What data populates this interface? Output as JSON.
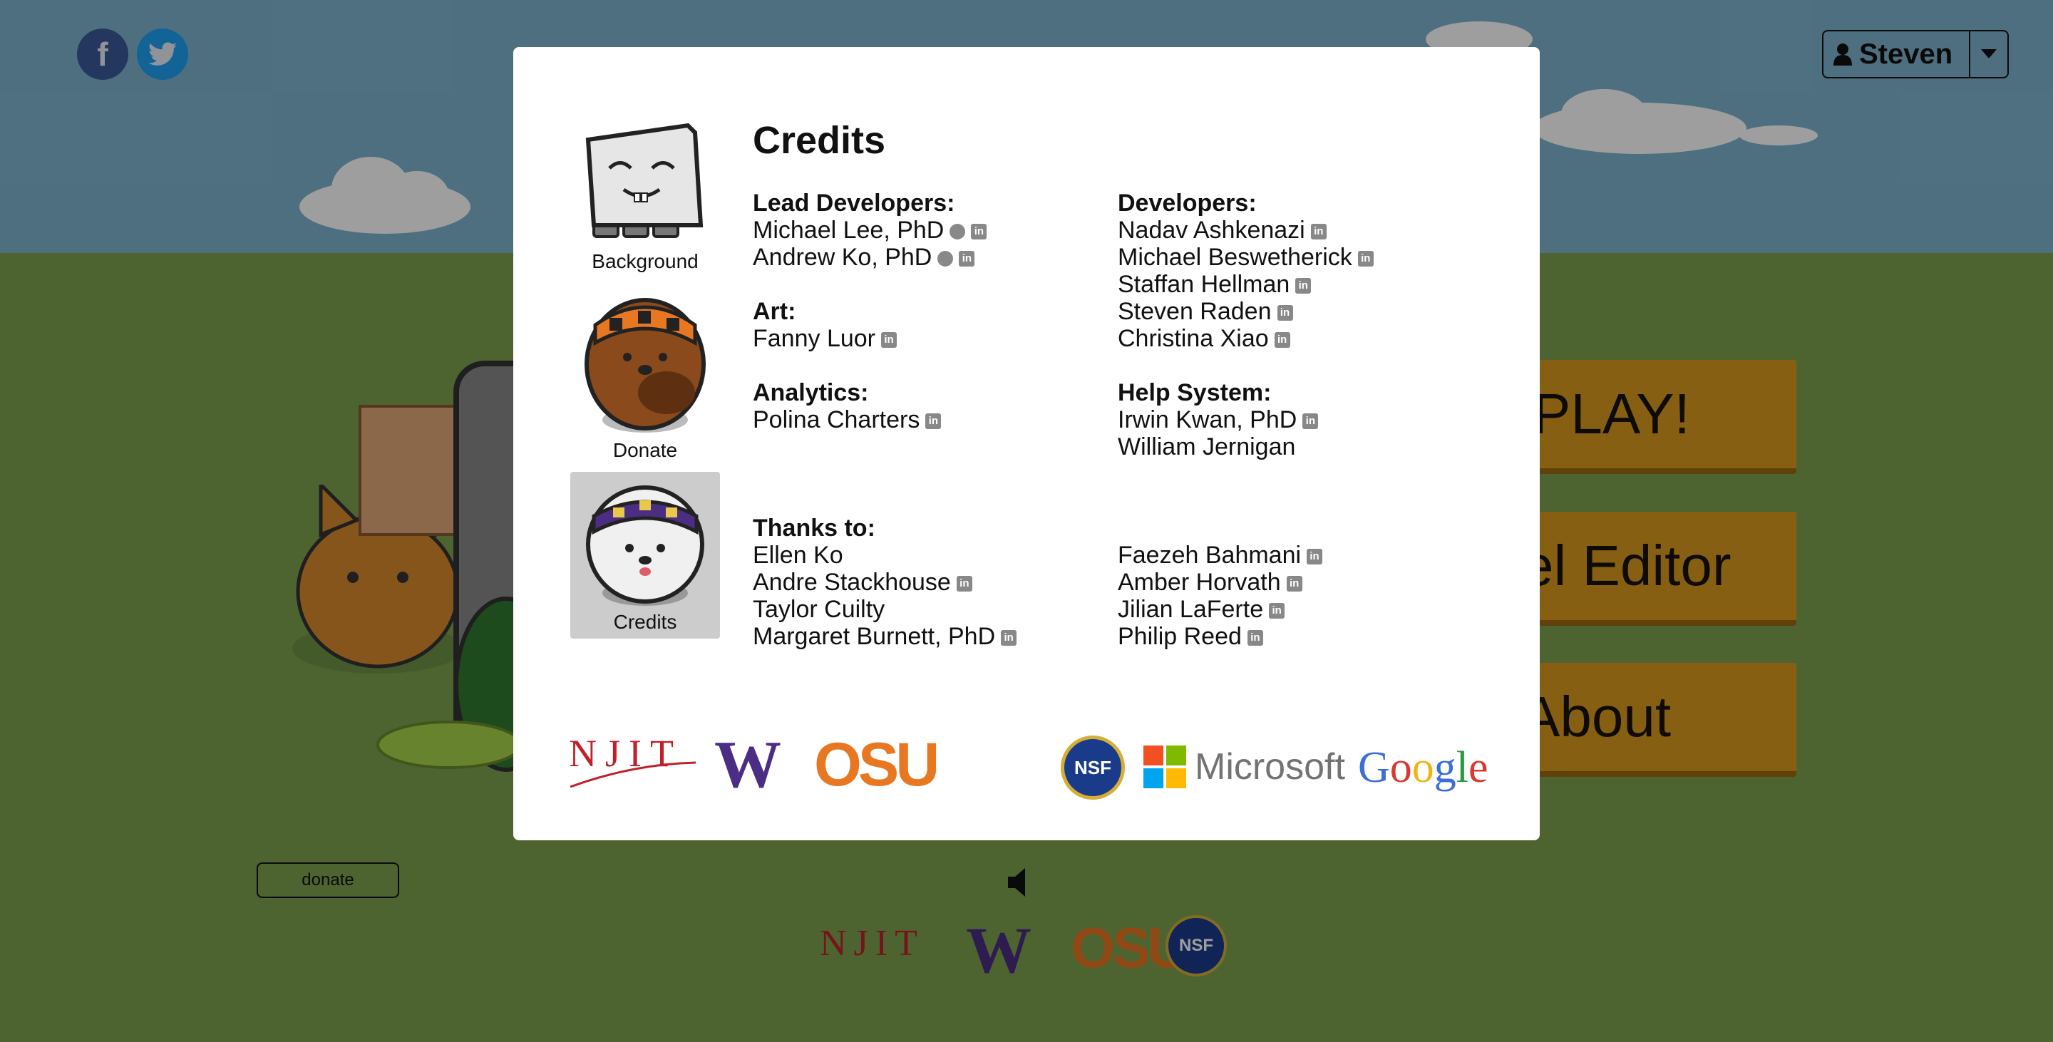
{
  "header": {
    "facebook_icon": "f",
    "user_name": "Steven",
    "user_icon": "user-icon",
    "dropdown_icon": "caret-down-icon"
  },
  "menu": {
    "play_label": "PLAY!",
    "level_editor_label": "el Editor",
    "about_label": "About"
  },
  "footer": {
    "donate_label": "donate",
    "sound_icon": "speaker-icon",
    "logos": [
      "NJIT",
      "W",
      "OSU",
      "NSF"
    ]
  },
  "dialog": {
    "title": "Credits",
    "sidebar": [
      {
        "label": "Background",
        "icon": "paper-character-icon"
      },
      {
        "label": "Donate",
        "icon": "beaver-character-icon"
      },
      {
        "label": "Credits",
        "icon": "husky-character-icon"
      }
    ],
    "lead_developers": {
      "heading": "Lead Developers:",
      "people": [
        "Michael Lee, PhD",
        "Andrew Ko, PhD"
      ]
    },
    "art": {
      "heading": "Art:",
      "people": [
        "Fanny Luor"
      ]
    },
    "analytics": {
      "heading": "Analytics:",
      "people": [
        "Polina Charters"
      ]
    },
    "developers": {
      "heading": "Developers:",
      "people": [
        "Nadav Ashkenazi",
        "Michael Beswetherick",
        "Staffan Hellman",
        "Steven Raden",
        "Christina Xiao"
      ]
    },
    "help_system": {
      "heading": "Help System:",
      "people": [
        "Irwin Kwan, PhD",
        "William Jernigan"
      ]
    },
    "thanks": {
      "heading": "Thanks to:",
      "left": [
        "Ellen Ko",
        "Andre Stackhouse",
        "Taylor Cuilty",
        "Margaret Burnett, PhD"
      ],
      "right": [
        "Faezeh Bahmani",
        "Amber Horvath",
        "Jilian LaFerte",
        "Philip Reed"
      ]
    },
    "logos": {
      "njit": "NJIT",
      "uw": "W",
      "osu": "OSU",
      "nsf": "NSF",
      "microsoft": "Microsoft",
      "google": [
        "G",
        "o",
        "o",
        "g",
        "l",
        "e"
      ]
    },
    "linkedin_glyph": "in"
  },
  "colors": {
    "sky": "#4a7a8c",
    "grass": "#4f6b33",
    "button": "#8a5f0d",
    "facebook": "#3b5998",
    "twitter": "#1da1f2",
    "osu": "#e87722",
    "uw": "#4b2e83",
    "njit": "#c0202a"
  }
}
